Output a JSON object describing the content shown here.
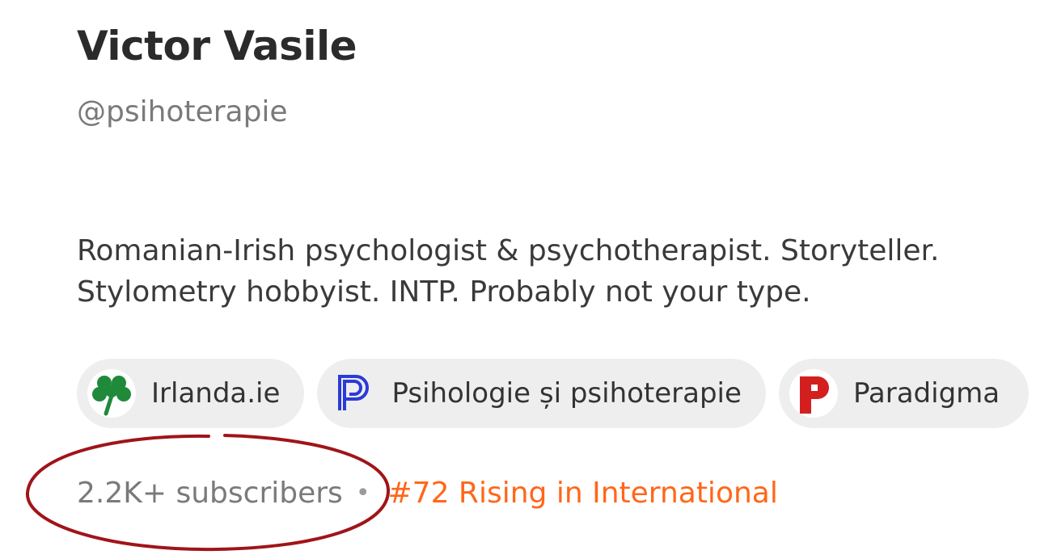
{
  "profile": {
    "name": "Victor Vasile",
    "handle": "@psihoterapie",
    "bio_line1": "Romanian-Irish psychologist & psychotherapist. Storyteller.",
    "bio_line2": "Stylometry hobbyist. INTP. Probably not your type."
  },
  "publications": [
    {
      "label": "Irlanda.ie",
      "icon": "shamrock-icon",
      "color": "#1f8a3a"
    },
    {
      "label": "Psihologie și psihoterapie",
      "icon": "p-logo-icon",
      "color": "#2b3bd6"
    },
    {
      "label": "Paradigma",
      "icon": "red-p-icon",
      "color": "#d41f1f"
    }
  ],
  "stats": {
    "subscribers": "2.2K+ subscribers",
    "separator": "•",
    "ranking": "#72 Rising in International"
  },
  "annotation": {
    "color": "#a0141a"
  },
  "colors": {
    "accent": "#ff6719",
    "chip_bg": "#eeeeee"
  }
}
